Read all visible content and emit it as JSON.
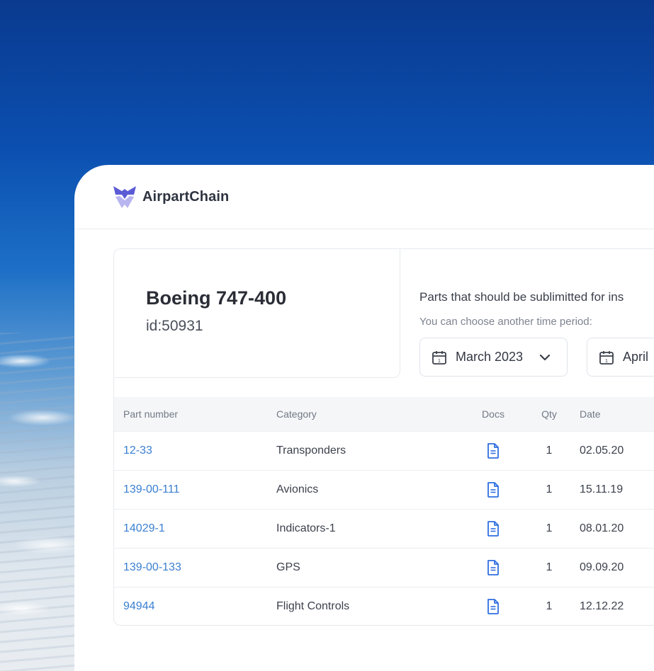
{
  "app": {
    "name": "AirpartChain"
  },
  "aircraft": {
    "name": "Boeing 747-400",
    "id": "id:50931"
  },
  "parts_info": {
    "title": "Parts that should be sublimitted for ins",
    "subtitle": "You can choose another time period:"
  },
  "date_filters": [
    {
      "label": "March 2023"
    },
    {
      "label": "April"
    }
  ],
  "table": {
    "headers": [
      "Part number",
      "Category",
      "Docs",
      "Qty",
      "Date"
    ],
    "rows": [
      {
        "part": "12-33",
        "category": "Transponders",
        "qty": "1",
        "date": "02.05.20"
      },
      {
        "part": "139-00-111",
        "category": "Avionics",
        "qty": "1",
        "date": "15.11.19"
      },
      {
        "part": "14029-1",
        "category": "Indicators-1",
        "qty": "1",
        "date": "08.01.20"
      },
      {
        "part": "139-00-133",
        "category": "GPS",
        "qty": "1",
        "date": "09.09.20"
      },
      {
        "part": "94944",
        "category": "Flight Controls",
        "qty": "1",
        "date": "12.12.22"
      }
    ]
  },
  "colors": {
    "brand": "#5b5bd6",
    "link": "#3a7fd0",
    "doc_icon": "#2f6fe0"
  }
}
